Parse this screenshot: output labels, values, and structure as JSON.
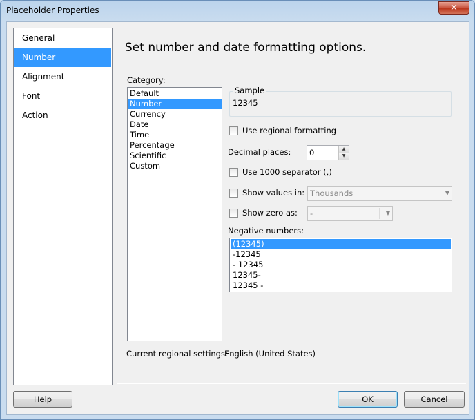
{
  "window": {
    "title": "Placeholder Properties",
    "close_label": "✕"
  },
  "nav": {
    "items": [
      {
        "label": "General",
        "selected": false
      },
      {
        "label": "Number",
        "selected": true
      },
      {
        "label": "Alignment",
        "selected": false
      },
      {
        "label": "Font",
        "selected": false
      },
      {
        "label": "Action",
        "selected": false
      }
    ]
  },
  "page": {
    "heading": "Set number and date formatting options.",
    "category_label": "Category:",
    "categories": [
      "Default",
      "Number",
      "Currency",
      "Date",
      "Time",
      "Percentage",
      "Scientific",
      "Custom"
    ],
    "selected_category": "Number",
    "sample_label": "Sample",
    "sample_value": "12345",
    "regional_formatting_label": "Use regional formatting",
    "decimal_places_label": "Decimal places:",
    "decimal_places_value": "0",
    "separator_label": "Use 1000 separator (,)",
    "show_values_label": "Show values in:",
    "show_values_value": "Thousands",
    "show_zero_label": "Show zero as:",
    "show_zero_value": "-",
    "negative_numbers_label": "Negative numbers:",
    "negative_numbers": [
      "(12345)",
      "-12345",
      "- 12345",
      "12345-",
      "12345 -"
    ],
    "selected_negative": "(12345)",
    "regional_settings_label": "Current regional settings:",
    "regional_settings_value": "English (United States)"
  },
  "buttons": {
    "help": "Help",
    "ok": "OK",
    "cancel": "Cancel"
  },
  "icons": {
    "spin_up": "spin-up-arrow",
    "spin_down": "spin-down-arrow",
    "dropdown": "chevron-down"
  }
}
